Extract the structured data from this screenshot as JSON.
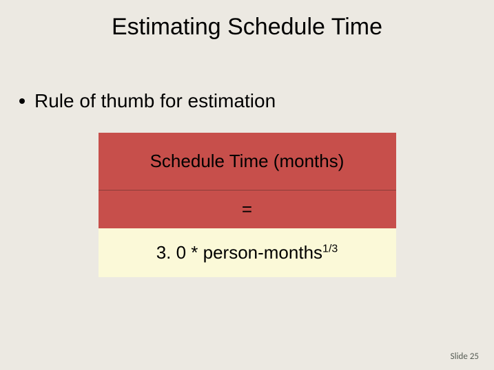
{
  "title": "Estimating Schedule Time",
  "bullet": "Rule of thumb for estimation",
  "formula": {
    "line1": "Schedule Time (months)",
    "equals": "=",
    "line2_prefix": "3. 0 * person-months",
    "line2_exp": "1/3"
  },
  "footer": {
    "label": "Slide",
    "number": "25"
  }
}
